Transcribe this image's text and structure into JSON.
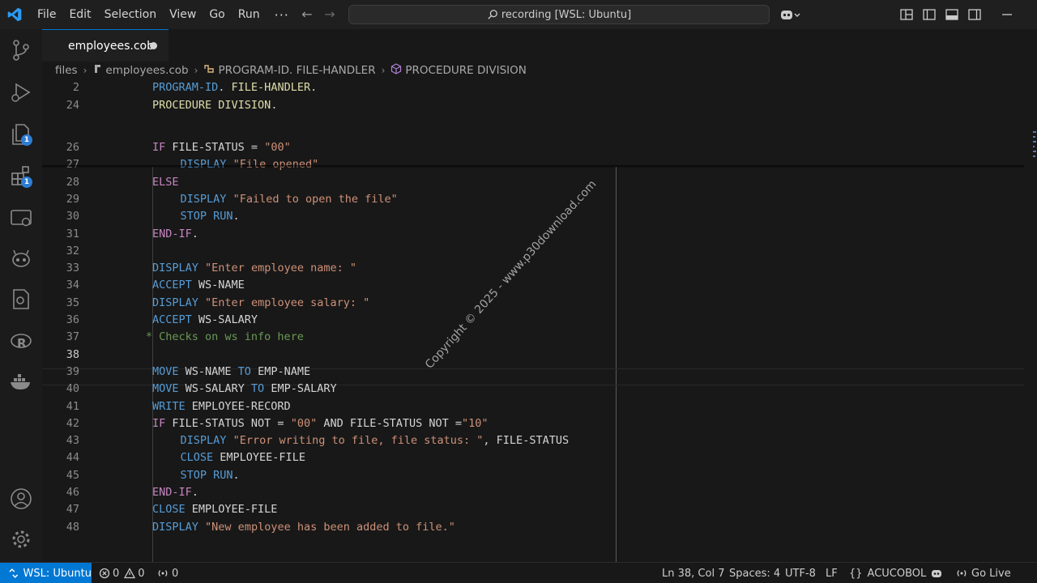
{
  "menu": {
    "items": [
      "File",
      "Edit",
      "Selection",
      "View",
      "Go",
      "Run"
    ],
    "more": "···"
  },
  "command_center": {
    "text": "recording [WSL: Ubuntu]"
  },
  "activity": {
    "source_control_badge": "1",
    "extensions_badge": "1"
  },
  "tab": {
    "label": "employees.cob"
  },
  "breadcrumb": {
    "items": [
      "files",
      "employees.cob",
      "PROGRAM-ID. FILE-HANDLER",
      "PROCEDURE DIVISION"
    ]
  },
  "sticky": [
    {
      "num": "2",
      "tokens": [
        [
          "b",
          "PROGRAM-ID"
        ],
        [
          "i",
          ". "
        ],
        [
          "y",
          "FILE-HANDLER"
        ],
        [
          "i",
          "."
        ]
      ]
    },
    {
      "num": "24",
      "tokens": [
        [
          "y",
          "PROCEDURE DIVISION"
        ],
        [
          "i",
          "."
        ]
      ]
    }
  ],
  "lines": [
    {
      "num": "26",
      "indent": 0,
      "tokens": [
        [
          "k",
          "IF"
        ],
        [
          "i",
          " FILE-STATUS = "
        ],
        [
          "s",
          "\"00\""
        ]
      ]
    },
    {
      "num": "27",
      "indent": 4,
      "tokens": [
        [
          "b",
          "DISPLAY"
        ],
        [
          "i",
          " "
        ],
        [
          "s",
          "\"File opened\""
        ]
      ]
    },
    {
      "num": "28",
      "indent": 0,
      "tokens": [
        [
          "k",
          "ELSE"
        ]
      ]
    },
    {
      "num": "29",
      "indent": 4,
      "tokens": [
        [
          "b",
          "DISPLAY"
        ],
        [
          "i",
          " "
        ],
        [
          "s",
          "\"Failed to open the file\""
        ]
      ]
    },
    {
      "num": "30",
      "indent": 4,
      "tokens": [
        [
          "b",
          "STOP RUN"
        ],
        [
          "i",
          "."
        ]
      ]
    },
    {
      "num": "31",
      "indent": 0,
      "tokens": [
        [
          "k",
          "END-IF"
        ],
        [
          "i",
          "."
        ]
      ]
    },
    {
      "num": "32",
      "indent": 0,
      "tokens": []
    },
    {
      "num": "33",
      "indent": 0,
      "tokens": [
        [
          "b",
          "DISPLAY"
        ],
        [
          "i",
          " "
        ],
        [
          "s",
          "\"Enter employee name: \""
        ]
      ]
    },
    {
      "num": "34",
      "indent": 0,
      "tokens": [
        [
          "b",
          "ACCEPT"
        ],
        [
          "i",
          " WS-NAME"
        ]
      ]
    },
    {
      "num": "35",
      "indent": 0,
      "tokens": [
        [
          "b",
          "DISPLAY"
        ],
        [
          "i",
          " "
        ],
        [
          "s",
          "\"Enter employee salary: \""
        ]
      ]
    },
    {
      "num": "36",
      "indent": 0,
      "tokens": [
        [
          "b",
          "ACCEPT"
        ],
        [
          "i",
          " WS-SALARY"
        ]
      ]
    },
    {
      "num": "37",
      "indent": -1,
      "tokens": [
        [
          "c",
          "* Checks on ws info here"
        ]
      ]
    },
    {
      "num": "38",
      "indent": 0,
      "tokens": [],
      "current": true
    },
    {
      "num": "39",
      "indent": 0,
      "tokens": [
        [
          "b",
          "MOVE"
        ],
        [
          "i",
          " WS-NAME "
        ],
        [
          "b",
          "TO"
        ],
        [
          "i",
          " EMP-NAME"
        ]
      ]
    },
    {
      "num": "40",
      "indent": 0,
      "tokens": [
        [
          "b",
          "MOVE"
        ],
        [
          "i",
          " WS-SALARY "
        ],
        [
          "b",
          "TO"
        ],
        [
          "i",
          " EMP-SALARY"
        ]
      ]
    },
    {
      "num": "41",
      "indent": 0,
      "tokens": [
        [
          "b",
          "WRITE"
        ],
        [
          "i",
          " EMPLOYEE-RECORD"
        ]
      ]
    },
    {
      "num": "42",
      "indent": 0,
      "tokens": [
        [
          "k",
          "IF"
        ],
        [
          "i",
          " FILE-STATUS NOT = "
        ],
        [
          "s",
          "\"00\""
        ],
        [
          "i",
          " AND FILE-STATUS NOT ="
        ],
        [
          "s",
          "\"10\""
        ]
      ]
    },
    {
      "num": "43",
      "indent": 4,
      "tokens": [
        [
          "b",
          "DISPLAY"
        ],
        [
          "i",
          " "
        ],
        [
          "s",
          "\"Error writing to file, file status: \""
        ],
        [
          "i",
          ", FILE-STATUS"
        ]
      ]
    },
    {
      "num": "44",
      "indent": 4,
      "tokens": [
        [
          "b",
          "CLOSE"
        ],
        [
          "i",
          " EMPLOYEE-FILE"
        ]
      ]
    },
    {
      "num": "45",
      "indent": 4,
      "tokens": [
        [
          "b",
          "STOP RUN"
        ],
        [
          "i",
          "."
        ]
      ]
    },
    {
      "num": "46",
      "indent": 0,
      "tokens": [
        [
          "k",
          "END-IF"
        ],
        [
          "i",
          "."
        ]
      ]
    },
    {
      "num": "47",
      "indent": 0,
      "tokens": [
        [
          "b",
          "CLOSE"
        ],
        [
          "i",
          " EMPLOYEE-FILE"
        ]
      ]
    },
    {
      "num": "48",
      "indent": 0,
      "tokens": [
        [
          "b",
          "DISPLAY"
        ],
        [
          "i",
          " "
        ],
        [
          "s",
          "\"New employee has been added to file.\""
        ]
      ]
    }
  ],
  "watermark": "Copyright © 2025 - www.p30download.com",
  "status": {
    "remote": "WSL: Ubuntu",
    "errors": "0",
    "warnings": "0",
    "ports": "0",
    "position": "Ln 38, Col 7",
    "spaces": "Spaces: 4",
    "encoding": "UTF-8",
    "eol": "LF",
    "language": "ACUCOBOL",
    "golive": "Go Live"
  },
  "colors": {
    "accent": "#0078d4",
    "keyword": "#c586c0",
    "builtin": "#569cd6",
    "string": "#ce9178",
    "comment": "#6a9955"
  }
}
